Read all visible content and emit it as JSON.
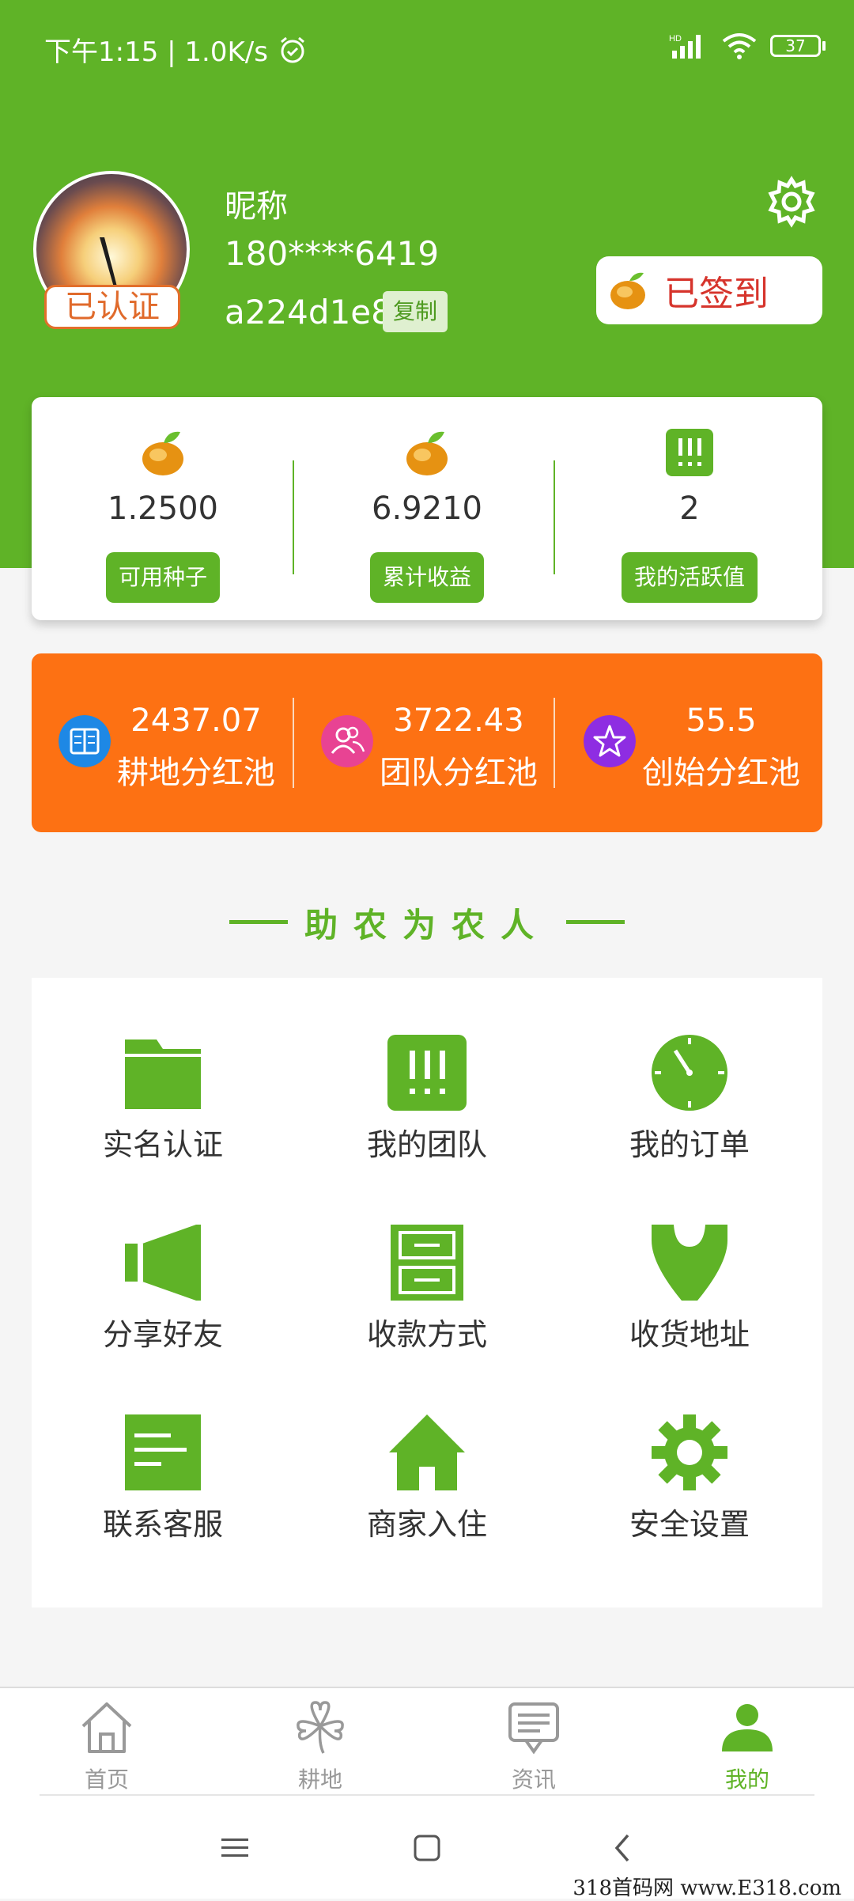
{
  "status_bar": {
    "time_speed": "下午1:15 | 1.0K/s",
    "battery": "37"
  },
  "profile": {
    "verified_label": "已认证",
    "nickname": "昵称",
    "phone": "180****6419",
    "uid": "a224d1e8",
    "copy_label": "复制",
    "signin_label": "已签到"
  },
  "stats": [
    {
      "value": "1.2500",
      "label": "可用种子",
      "icon": "bean-icon"
    },
    {
      "value": "6.9210",
      "label": "累计收益",
      "icon": "bean-icon"
    },
    {
      "value": "2",
      "label": "我的活跃值",
      "icon": "team-icon"
    }
  ],
  "pools": [
    {
      "value": "2437.07",
      "label": "耕地分红池",
      "icon": "book-icon",
      "color": "#1e88e5"
    },
    {
      "value": "3722.43",
      "label": "团队分红池",
      "icon": "people-icon",
      "color": "#e84393"
    },
    {
      "value": "55.5",
      "label": "创始分红池",
      "icon": "star-icon",
      "color": "#8e2de2"
    }
  ],
  "section_title": "助农为农人",
  "menu": [
    {
      "label": "实名认证",
      "icon": "folder-icon"
    },
    {
      "label": "我的团队",
      "icon": "team-icon"
    },
    {
      "label": "我的订单",
      "icon": "clock-icon"
    },
    {
      "label": "分享好友",
      "icon": "speaker-icon"
    },
    {
      "label": "收款方式",
      "icon": "drawer-icon"
    },
    {
      "label": "收货地址",
      "icon": "location-icon"
    },
    {
      "label": "联系客服",
      "icon": "document-icon"
    },
    {
      "label": "商家入住",
      "icon": "house-icon"
    },
    {
      "label": "安全设置",
      "icon": "gear-icon"
    }
  ],
  "nav": [
    {
      "label": "首页",
      "icon": "home-icon",
      "active": false
    },
    {
      "label": "耕地",
      "icon": "clover-icon",
      "active": false
    },
    {
      "label": "资讯",
      "icon": "message-icon",
      "active": false
    },
    {
      "label": "我的",
      "icon": "user-icon",
      "active": true
    }
  ],
  "watermark": "318首码网 www.E318.com",
  "colors": {
    "primary": "#5fb327",
    "orange": "#fd7113",
    "signin_red": "#d6342c"
  }
}
